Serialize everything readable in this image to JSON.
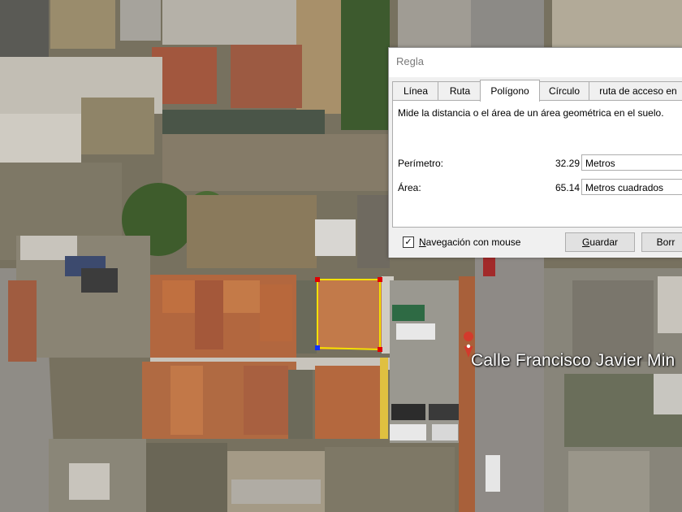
{
  "dialog": {
    "title": "Regla",
    "tabs": [
      {
        "label": "Línea"
      },
      {
        "label": "Ruta"
      },
      {
        "label": "Polígono"
      },
      {
        "label": "Círculo"
      },
      {
        "label": "ruta de acceso en"
      }
    ],
    "active_tab": "Polígono",
    "description": "Mide la distancia o el área de un área geométrica en el suelo.",
    "perimeter": {
      "label": "Perímetro:",
      "value": "32.29",
      "unit": "Metros"
    },
    "area": {
      "label": "Área:",
      "value": "65.14",
      "unit": "Metros cuadrados"
    },
    "mouse_nav": {
      "label": "Navegación con mouse",
      "checked": true
    },
    "save_button": "Guardar",
    "clear_button": "Borr"
  },
  "map": {
    "street_label": "Calle Francisco Javier Min",
    "polygon_color": "#f5e000",
    "vertex_color": "#e00000",
    "active_vertex_color": "#1030ff",
    "pin_color": "#d33a2c"
  }
}
